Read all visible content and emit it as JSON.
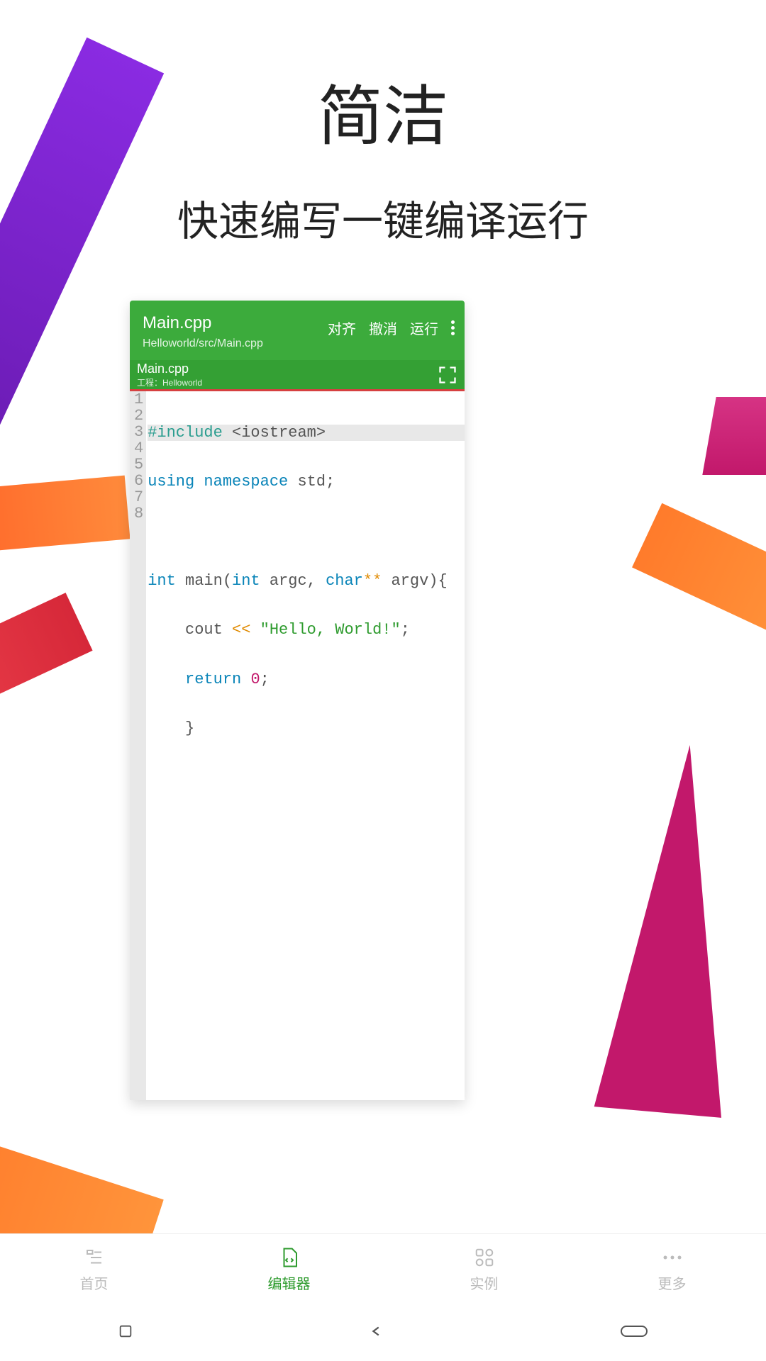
{
  "hero": {
    "title": "简洁",
    "subtitle": "快速编写一键编译运行"
  },
  "editor": {
    "filename": "Main.cpp",
    "path": "Helloworld/src/Main.cpp",
    "actions": {
      "align": "对齐",
      "undo": "撤消",
      "run": "运行"
    },
    "sub": {
      "filename": "Main.cpp",
      "project_label": "工程：Helloworld"
    },
    "gutter": [
      "1",
      "2",
      "3",
      "4",
      "5",
      "6",
      "7",
      "8"
    ],
    "code": {
      "l1_a": "#include ",
      "l1_b": "<iostream>",
      "l2_a": "using ",
      "l2_b": "namespace ",
      "l2_c": "std;",
      "l3": "",
      "l4_a": "int ",
      "l4_b": "main(",
      "l4_c": "int ",
      "l4_d": "argc, ",
      "l4_e": "char",
      "l4_f": "** ",
      "l4_g": "argv){",
      "l5_a": "    cout ",
      "l5_b": "<< ",
      "l5_c": "\"Hello, World!\"",
      "l5_d": ";",
      "l6_a": "    return ",
      "l6_b": "0",
      "l6_c": ";",
      "l7": "    }",
      "l8": ""
    }
  },
  "nav": {
    "home": "首页",
    "editor": "编辑器",
    "examples": "实例",
    "more": "更多"
  }
}
